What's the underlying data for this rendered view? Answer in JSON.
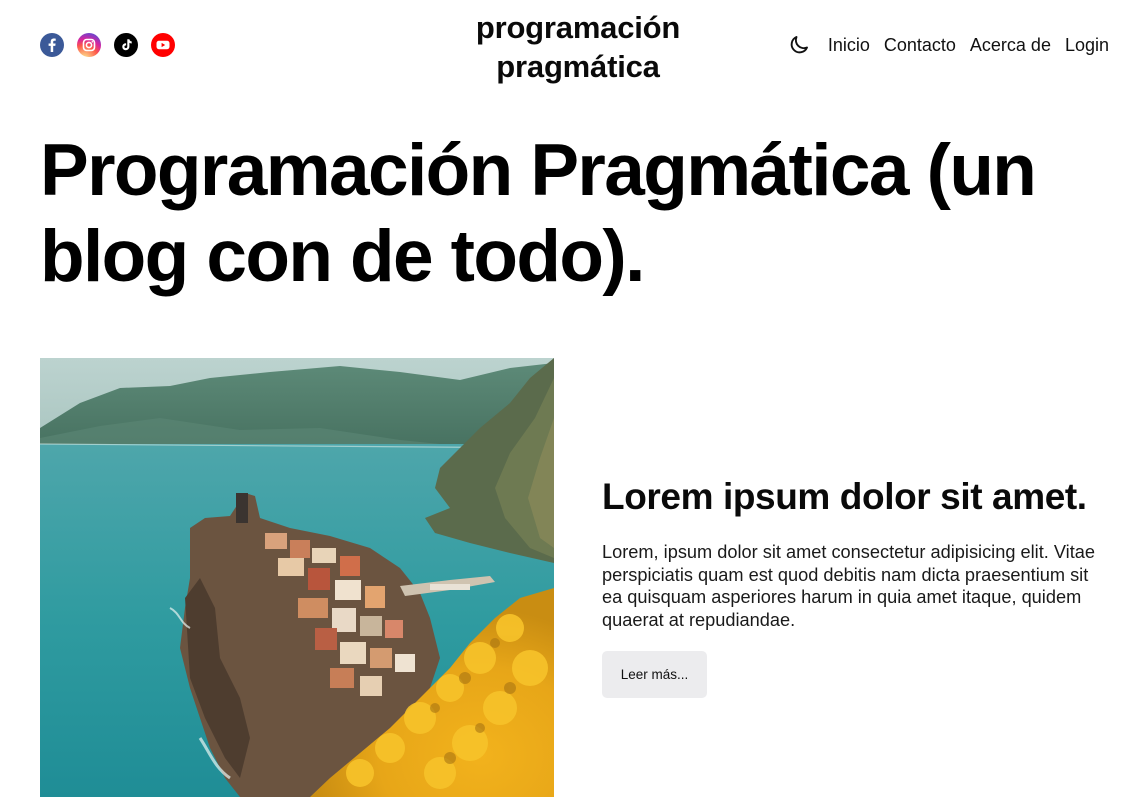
{
  "header": {
    "site_title_line1": "programación",
    "site_title_line2": "pragmática",
    "socials": [
      {
        "name": "facebook",
        "icon": "facebook-icon",
        "color": "#3b5998"
      },
      {
        "name": "instagram",
        "icon": "instagram-icon",
        "color": "#d6249f"
      },
      {
        "name": "tiktok",
        "icon": "tiktok-icon",
        "color": "#000000"
      },
      {
        "name": "youtube",
        "icon": "youtube-icon",
        "color": "#ff0000"
      }
    ],
    "theme_toggle_icon": "moon-icon",
    "nav": {
      "inicio": "Inicio",
      "contacto": "Contacto",
      "acerca": "Acerca de",
      "login": "Login"
    }
  },
  "hero": {
    "title": "Programación Pragmática (un blog con de todo)."
  },
  "post": {
    "image": "coastal-village-photo",
    "title": "Lorem ipsum dolor sit amet.",
    "excerpt": "Lorem, ipsum dolor sit amet consectetur adipisicing elit. Vitae perspiciatis quam est quod debitis nam dicta praesentium sit ea quisquam asperiores harum in quia amet itaque, quidem quaerat at repudiandae.",
    "read_more": "Leer más..."
  }
}
